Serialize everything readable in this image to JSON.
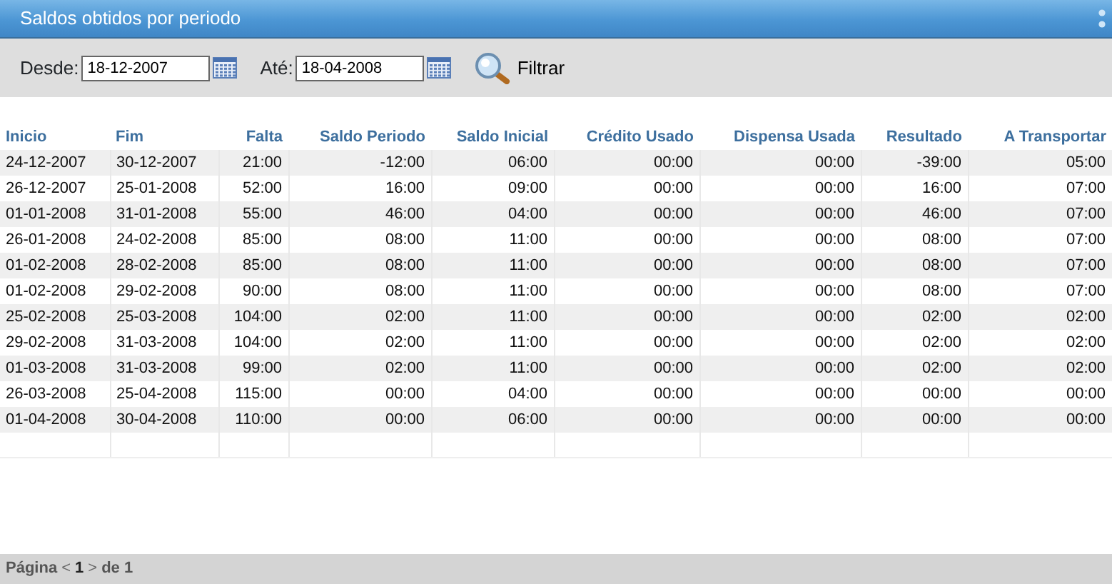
{
  "window": {
    "title": "Saldos obtidos por periodo"
  },
  "filter": {
    "from_label": "Desde:",
    "from_value": "18-12-2007",
    "to_label": "Até:",
    "to_value": "18-04-2008",
    "button": "Filtrar"
  },
  "table": {
    "columns": [
      "Inicio",
      "Fim",
      "Falta",
      "Saldo Periodo",
      "Saldo Inicial",
      "Crédito Usado",
      "Dispensa Usada",
      "Resultado",
      "A Transportar"
    ],
    "rows": [
      [
        "24-12-2007",
        "30-12-2007",
        "21:00",
        "-12:00",
        "06:00",
        "00:00",
        "00:00",
        "-39:00",
        "05:00"
      ],
      [
        "26-12-2007",
        "25-01-2008",
        "52:00",
        "16:00",
        "09:00",
        "00:00",
        "00:00",
        "16:00",
        "07:00"
      ],
      [
        "01-01-2008",
        "31-01-2008",
        "55:00",
        "46:00",
        "04:00",
        "00:00",
        "00:00",
        "46:00",
        "07:00"
      ],
      [
        "26-01-2008",
        "24-02-2008",
        "85:00",
        "08:00",
        "11:00",
        "00:00",
        "00:00",
        "08:00",
        "07:00"
      ],
      [
        "01-02-2008",
        "28-02-2008",
        "85:00",
        "08:00",
        "11:00",
        "00:00",
        "00:00",
        "08:00",
        "07:00"
      ],
      [
        "01-02-2008",
        "29-02-2008",
        "90:00",
        "08:00",
        "11:00",
        "00:00",
        "00:00",
        "08:00",
        "07:00"
      ],
      [
        "25-02-2008",
        "25-03-2008",
        "104:00",
        "02:00",
        "11:00",
        "00:00",
        "00:00",
        "02:00",
        "02:00"
      ],
      [
        "29-02-2008",
        "31-03-2008",
        "104:00",
        "02:00",
        "11:00",
        "00:00",
        "00:00",
        "02:00",
        "02:00"
      ],
      [
        "01-03-2008",
        "31-03-2008",
        "99:00",
        "02:00",
        "11:00",
        "00:00",
        "00:00",
        "02:00",
        "02:00"
      ],
      [
        "26-03-2008",
        "25-04-2008",
        "115:00",
        "00:00",
        "04:00",
        "00:00",
        "00:00",
        "00:00",
        "00:00"
      ],
      [
        "01-04-2008",
        "30-04-2008",
        "110:00",
        "00:00",
        "06:00",
        "00:00",
        "00:00",
        "00:00",
        "00:00"
      ]
    ]
  },
  "pager": {
    "label": "Página",
    "prev": "<",
    "page": "1",
    "next": ">",
    "of": "de 1"
  }
}
